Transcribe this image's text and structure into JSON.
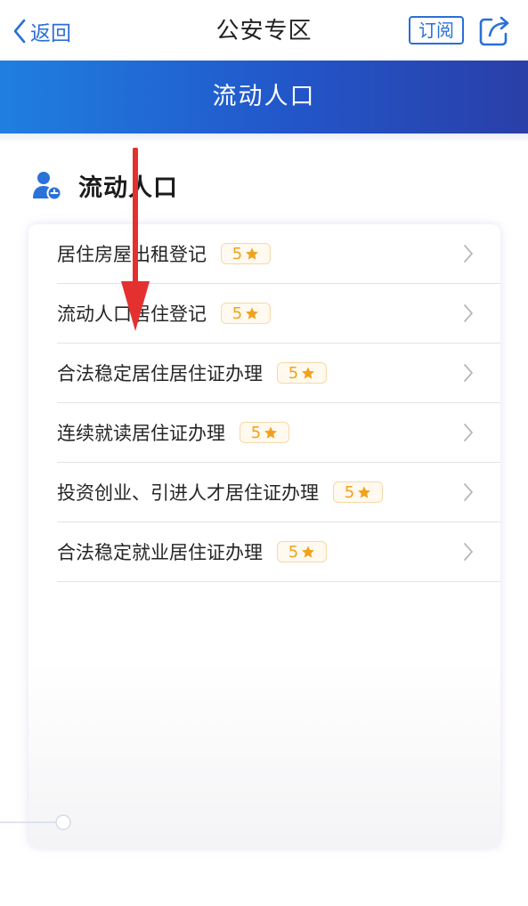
{
  "nav": {
    "back_label": "返回",
    "title": "公安专区",
    "subscribe_label": "订阅"
  },
  "banner": {
    "title": "流动人口"
  },
  "section": {
    "title": "流动人口"
  },
  "items": [
    {
      "label": "居住房屋出租登记",
      "rating": "5"
    },
    {
      "label": "流动人口居住登记",
      "rating": "5"
    },
    {
      "label": "合法稳定居住居住证办理",
      "rating": "5"
    },
    {
      "label": "连续就读居住证办理",
      "rating": "5"
    },
    {
      "label": "投资创业、引进人才居住证办理",
      "rating": "5"
    },
    {
      "label": "合法稳定就业居住证办理",
      "rating": "5"
    }
  ],
  "colors": {
    "accent_blue": "#2a6fd6",
    "banner_start": "#1f7fe0",
    "banner_end": "#2a3fa8",
    "star_orange": "#f0a21c",
    "arrow_red": "#e53030"
  },
  "icons": {
    "back": "chevron-left-icon",
    "share": "share-icon",
    "section": "person-icon",
    "rating": "star-icon",
    "row": "chevron-right-icon"
  }
}
